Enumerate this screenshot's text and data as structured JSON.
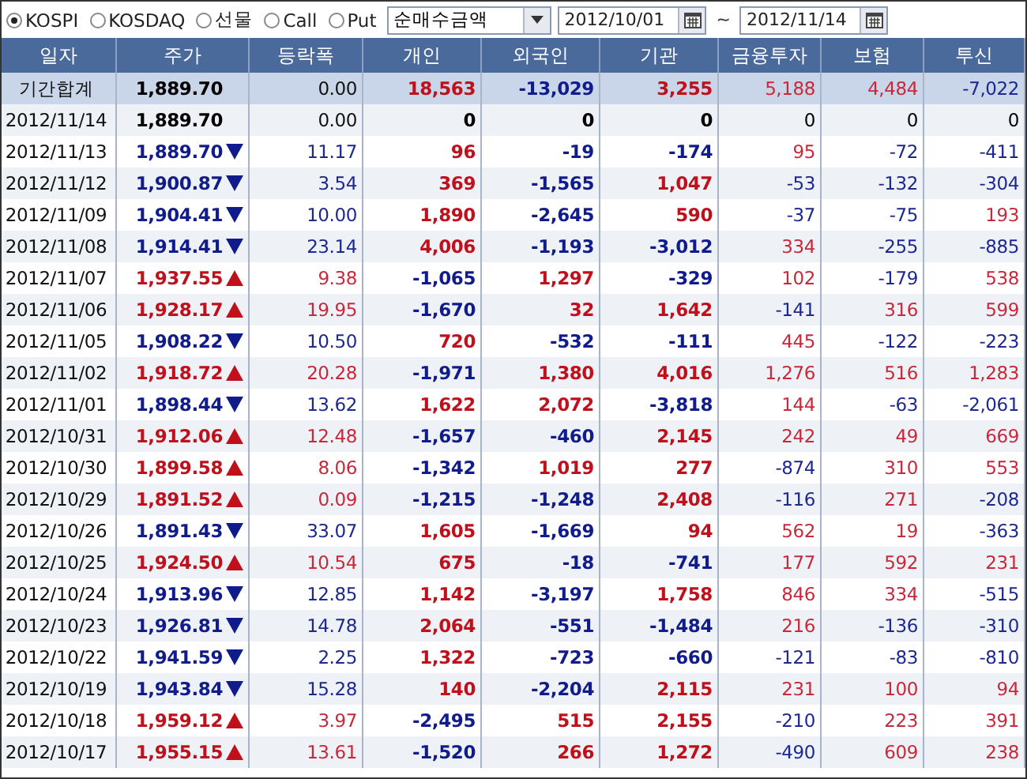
{
  "toolbar": {
    "markets": [
      {
        "label": "KOSPI",
        "selected": true
      },
      {
        "label": "KOSDAQ",
        "selected": false
      },
      {
        "label": "선물",
        "selected": false
      },
      {
        "label": "Call",
        "selected": false
      },
      {
        "label": "Put",
        "selected": false
      }
    ],
    "mode_select": {
      "value": "순매수금액"
    },
    "date_from": {
      "value": "2012/10/01"
    },
    "range_separator": "~",
    "date_to": {
      "value": "2012/11/14"
    }
  },
  "table": {
    "columns": [
      "일자",
      "주가",
      "등락폭",
      "개인",
      "외국인",
      "기관",
      "금융투자",
      "보험",
      "투신"
    ],
    "rows": [
      {
        "kind": "summary",
        "date": "기간합계",
        "rising": false,
        "falling": false,
        "price": "1,889.70",
        "change": "0.00",
        "values": [
          {
            "text": "18,563",
            "color": "#c0101c"
          },
          {
            "text": "-13,029",
            "color": "#101c8c"
          },
          {
            "text": "3,255",
            "color": "#c0101c"
          },
          {
            "text": "5,188",
            "color": "#c8283a"
          },
          {
            "text": "4,484",
            "color": "#c8283a"
          },
          {
            "text": "-7,022",
            "color": "#1c2890"
          }
        ]
      },
      {
        "kind": "day",
        "date": "2012/11/14",
        "rising": false,
        "falling": false,
        "price": "1,889.70",
        "change": "0.00",
        "values": [
          {
            "text": "0",
            "color": "#000000"
          },
          {
            "text": "0",
            "color": "#000000"
          },
          {
            "text": "0",
            "color": "#000000"
          },
          {
            "text": "0",
            "color": "#000000"
          },
          {
            "text": "0",
            "color": "#000000"
          },
          {
            "text": "0",
            "color": "#000000"
          }
        ]
      },
      {
        "kind": "day",
        "date": "2012/11/13",
        "rising": false,
        "falling": true,
        "price": "1,889.70",
        "change": "11.17",
        "values": [
          {
            "text": "96",
            "color": "#c0101c"
          },
          {
            "text": "-19",
            "color": "#101c8c"
          },
          {
            "text": "-174",
            "color": "#101c8c"
          },
          {
            "text": "95",
            "color": "#c8283a"
          },
          {
            "text": "-72",
            "color": "#1c2890"
          },
          {
            "text": "-411",
            "color": "#1c2890"
          }
        ]
      },
      {
        "kind": "day",
        "date": "2012/11/12",
        "rising": false,
        "falling": true,
        "price": "1,900.87",
        "change": "3.54",
        "values": [
          {
            "text": "369",
            "color": "#c0101c"
          },
          {
            "text": "-1,565",
            "color": "#101c8c"
          },
          {
            "text": "1,047",
            "color": "#c0101c"
          },
          {
            "text": "-53",
            "color": "#1c2890"
          },
          {
            "text": "-132",
            "color": "#1c2890"
          },
          {
            "text": "-304",
            "color": "#1c2890"
          }
        ]
      },
      {
        "kind": "day",
        "date": "2012/11/09",
        "rising": false,
        "falling": true,
        "price": "1,904.41",
        "change": "10.00",
        "values": [
          {
            "text": "1,890",
            "color": "#c0101c"
          },
          {
            "text": "-2,645",
            "color": "#101c8c"
          },
          {
            "text": "590",
            "color": "#c0101c"
          },
          {
            "text": "-37",
            "color": "#1c2890"
          },
          {
            "text": "-75",
            "color": "#1c2890"
          },
          {
            "text": "193",
            "color": "#c8283a"
          }
        ]
      },
      {
        "kind": "day",
        "date": "2012/11/08",
        "rising": false,
        "falling": true,
        "price": "1,914.41",
        "change": "23.14",
        "values": [
          {
            "text": "4,006",
            "color": "#c0101c"
          },
          {
            "text": "-1,193",
            "color": "#101c8c"
          },
          {
            "text": "-3,012",
            "color": "#101c8c"
          },
          {
            "text": "334",
            "color": "#c8283a"
          },
          {
            "text": "-255",
            "color": "#1c2890"
          },
          {
            "text": "-885",
            "color": "#1c2890"
          }
        ]
      },
      {
        "kind": "day",
        "date": "2012/11/07",
        "rising": true,
        "falling": false,
        "price": "1,937.55",
        "change": "9.38",
        "values": [
          {
            "text": "-1,065",
            "color": "#101c8c"
          },
          {
            "text": "1,297",
            "color": "#c0101c"
          },
          {
            "text": "-329",
            "color": "#101c8c"
          },
          {
            "text": "102",
            "color": "#c8283a"
          },
          {
            "text": "-179",
            "color": "#1c2890"
          },
          {
            "text": "538",
            "color": "#c8283a"
          }
        ]
      },
      {
        "kind": "day",
        "date": "2012/11/06",
        "rising": true,
        "falling": false,
        "price": "1,928.17",
        "change": "19.95",
        "values": [
          {
            "text": "-1,670",
            "color": "#101c8c"
          },
          {
            "text": "32",
            "color": "#c0101c"
          },
          {
            "text": "1,642",
            "color": "#c0101c"
          },
          {
            "text": "-141",
            "color": "#1c2890"
          },
          {
            "text": "316",
            "color": "#c8283a"
          },
          {
            "text": "599",
            "color": "#c8283a"
          }
        ]
      },
      {
        "kind": "day",
        "date": "2012/11/05",
        "rising": false,
        "falling": true,
        "price": "1,908.22",
        "change": "10.50",
        "values": [
          {
            "text": "720",
            "color": "#c0101c"
          },
          {
            "text": "-532",
            "color": "#101c8c"
          },
          {
            "text": "-111",
            "color": "#101c8c"
          },
          {
            "text": "445",
            "color": "#c8283a"
          },
          {
            "text": "-122",
            "color": "#1c2890"
          },
          {
            "text": "-223",
            "color": "#1c2890"
          }
        ]
      },
      {
        "kind": "day",
        "date": "2012/11/02",
        "rising": true,
        "falling": false,
        "price": "1,918.72",
        "change": "20.28",
        "values": [
          {
            "text": "-1,971",
            "color": "#101c8c"
          },
          {
            "text": "1,380",
            "color": "#c0101c"
          },
          {
            "text": "4,016",
            "color": "#c0101c"
          },
          {
            "text": "1,276",
            "color": "#c8283a"
          },
          {
            "text": "516",
            "color": "#c8283a"
          },
          {
            "text": "1,283",
            "color": "#c8283a"
          }
        ]
      },
      {
        "kind": "day",
        "date": "2012/11/01",
        "rising": false,
        "falling": true,
        "price": "1,898.44",
        "change": "13.62",
        "values": [
          {
            "text": "1,622",
            "color": "#c0101c"
          },
          {
            "text": "2,072",
            "color": "#c0101c"
          },
          {
            "text": "-3,818",
            "color": "#101c8c"
          },
          {
            "text": "144",
            "color": "#c8283a"
          },
          {
            "text": "-63",
            "color": "#1c2890"
          },
          {
            "text": "-2,061",
            "color": "#1c2890"
          }
        ]
      },
      {
        "kind": "day",
        "date": "2012/10/31",
        "rising": true,
        "falling": false,
        "price": "1,912.06",
        "change": "12.48",
        "values": [
          {
            "text": "-1,657",
            "color": "#101c8c"
          },
          {
            "text": "-460",
            "color": "#101c8c"
          },
          {
            "text": "2,145",
            "color": "#c0101c"
          },
          {
            "text": "242",
            "color": "#c8283a"
          },
          {
            "text": "49",
            "color": "#c8283a"
          },
          {
            "text": "669",
            "color": "#c8283a"
          }
        ]
      },
      {
        "kind": "day",
        "date": "2012/10/30",
        "rising": true,
        "falling": false,
        "price": "1,899.58",
        "change": "8.06",
        "values": [
          {
            "text": "-1,342",
            "color": "#101c8c"
          },
          {
            "text": "1,019",
            "color": "#c0101c"
          },
          {
            "text": "277",
            "color": "#c0101c"
          },
          {
            "text": "-874",
            "color": "#1c2890"
          },
          {
            "text": "310",
            "color": "#c8283a"
          },
          {
            "text": "553",
            "color": "#c8283a"
          }
        ]
      },
      {
        "kind": "day",
        "date": "2012/10/29",
        "rising": true,
        "falling": false,
        "price": "1,891.52",
        "change": "0.09",
        "values": [
          {
            "text": "-1,215",
            "color": "#101c8c"
          },
          {
            "text": "-1,248",
            "color": "#101c8c"
          },
          {
            "text": "2,408",
            "color": "#c0101c"
          },
          {
            "text": "-116",
            "color": "#1c2890"
          },
          {
            "text": "271",
            "color": "#c8283a"
          },
          {
            "text": "-208",
            "color": "#1c2890"
          }
        ]
      },
      {
        "kind": "day",
        "date": "2012/10/26",
        "rising": false,
        "falling": true,
        "price": "1,891.43",
        "change": "33.07",
        "values": [
          {
            "text": "1,605",
            "color": "#c0101c"
          },
          {
            "text": "-1,669",
            "color": "#101c8c"
          },
          {
            "text": "94",
            "color": "#c0101c"
          },
          {
            "text": "562",
            "color": "#c8283a"
          },
          {
            "text": "19",
            "color": "#c8283a"
          },
          {
            "text": "-363",
            "color": "#1c2890"
          }
        ]
      },
      {
        "kind": "day",
        "date": "2012/10/25",
        "rising": true,
        "falling": false,
        "price": "1,924.50",
        "change": "10.54",
        "values": [
          {
            "text": "675",
            "color": "#c0101c"
          },
          {
            "text": "-18",
            "color": "#101c8c"
          },
          {
            "text": "-741",
            "color": "#101c8c"
          },
          {
            "text": "177",
            "color": "#c8283a"
          },
          {
            "text": "592",
            "color": "#c8283a"
          },
          {
            "text": "231",
            "color": "#c8283a"
          }
        ]
      },
      {
        "kind": "day",
        "date": "2012/10/24",
        "rising": false,
        "falling": true,
        "price": "1,913.96",
        "change": "12.85",
        "values": [
          {
            "text": "1,142",
            "color": "#c0101c"
          },
          {
            "text": "-3,197",
            "color": "#101c8c"
          },
          {
            "text": "1,758",
            "color": "#c0101c"
          },
          {
            "text": "846",
            "color": "#c8283a"
          },
          {
            "text": "334",
            "color": "#c8283a"
          },
          {
            "text": "-515",
            "color": "#1c2890"
          }
        ]
      },
      {
        "kind": "day",
        "date": "2012/10/23",
        "rising": false,
        "falling": true,
        "price": "1,926.81",
        "change": "14.78",
        "values": [
          {
            "text": "2,064",
            "color": "#c0101c"
          },
          {
            "text": "-551",
            "color": "#101c8c"
          },
          {
            "text": "-1,484",
            "color": "#101c8c"
          },
          {
            "text": "216",
            "color": "#c8283a"
          },
          {
            "text": "-136",
            "color": "#1c2890"
          },
          {
            "text": "-310",
            "color": "#1c2890"
          }
        ]
      },
      {
        "kind": "day",
        "date": "2012/10/22",
        "rising": false,
        "falling": true,
        "price": "1,941.59",
        "change": "2.25",
        "values": [
          {
            "text": "1,322",
            "color": "#c0101c"
          },
          {
            "text": "-723",
            "color": "#101c8c"
          },
          {
            "text": "-660",
            "color": "#101c8c"
          },
          {
            "text": "-121",
            "color": "#1c2890"
          },
          {
            "text": "-83",
            "color": "#1c2890"
          },
          {
            "text": "-810",
            "color": "#1c2890"
          }
        ]
      },
      {
        "kind": "day",
        "date": "2012/10/19",
        "rising": false,
        "falling": true,
        "price": "1,943.84",
        "change": "15.28",
        "values": [
          {
            "text": "140",
            "color": "#c0101c"
          },
          {
            "text": "-2,204",
            "color": "#101c8c"
          },
          {
            "text": "2,115",
            "color": "#c0101c"
          },
          {
            "text": "231",
            "color": "#c8283a"
          },
          {
            "text": "100",
            "color": "#c8283a"
          },
          {
            "text": "94",
            "color": "#c8283a"
          }
        ]
      },
      {
        "kind": "day",
        "date": "2012/10/18",
        "rising": true,
        "falling": false,
        "price": "1,959.12",
        "change": "3.97",
        "values": [
          {
            "text": "-2,495",
            "color": "#101c8c"
          },
          {
            "text": "515",
            "color": "#c0101c"
          },
          {
            "text": "2,155",
            "color": "#c0101c"
          },
          {
            "text": "-210",
            "color": "#1c2890"
          },
          {
            "text": "223",
            "color": "#c8283a"
          },
          {
            "text": "391",
            "color": "#c8283a"
          }
        ]
      },
      {
        "kind": "day",
        "date": "2012/10/17",
        "rising": true,
        "falling": false,
        "price": "1,955.15",
        "change": "13.61",
        "values": [
          {
            "text": "-1,520",
            "color": "#101c8c"
          },
          {
            "text": "266",
            "color": "#c0101c"
          },
          {
            "text": "1,272",
            "color": "#c0101c"
          },
          {
            "text": "-490",
            "color": "#1c2890"
          },
          {
            "text": "609",
            "color": "#c8283a"
          },
          {
            "text": "238",
            "color": "#c8283a"
          }
        ]
      }
    ]
  }
}
